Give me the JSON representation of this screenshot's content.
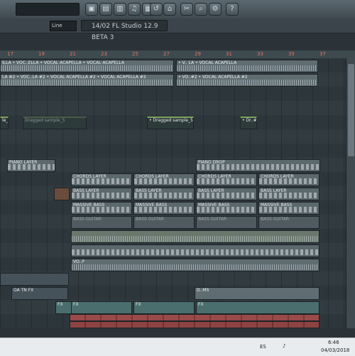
{
  "toolbar": {
    "line_mode": "Line",
    "hint_text": "14/02  FL Studio 12.9 BETA 3"
  },
  "ruler": {
    "bars": [
      "17",
      "19",
      "21",
      "23",
      "25",
      "27",
      "29",
      "31",
      "33",
      "35",
      "37"
    ]
  },
  "tracks": [
    {
      "label": "ILLA • VOC..ELLA • VOCAL ACAPELLA • VOCAL ACAPELLA",
      "label2": "• V.. LA • VOCAL ACAPELLA"
    },
    {
      "label": "LA #2 • VOC..LA #2 • VOCAL ACAPELLA #2 • VOCAL ACAPELLA #2",
      "label2": "• VO..#2 • VOCAL ACAPELLA #2"
    },
    {
      "dragged": [
        "le_#2",
        "Dragged sample_5",
        "• Dragged sample_5",
        "• Dr..#2"
      ]
    },
    {
      "piano_layer": "PIANO LAYER",
      "piano_drop": "PIANO DROP"
    },
    {
      "chords": "CHORDS LAYER"
    },
    {
      "bass": "BASS LAYER"
    },
    {
      "massive": "MASSIVE BASS"
    },
    {
      "guitar": "BASS GUITAR"
    },
    {
      "vo": "VO..P"
    },
    {
      "oa": "OA TN FX"
    },
    {
      "dms": "D..MS"
    },
    {
      "fx": "FX"
    }
  ],
  "taskbar": {
    "lang": "ES",
    "time": "6:46",
    "date": "04/03/2018"
  },
  "colors": {
    "accent_orange": "#e07a60",
    "clip_green": "#6c8f86",
    "clip_gray": "#5d6a70",
    "clip_teal": "#4a6e6e",
    "clip_red": "#9a4a4a"
  }
}
